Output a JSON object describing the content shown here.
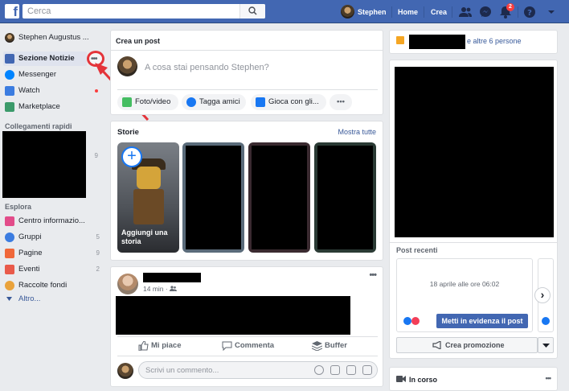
{
  "topbar": {
    "logo": "f",
    "search_placeholder": "Cerca",
    "user_name": "Stephen",
    "home": "Home",
    "create": "Crea",
    "notifications_badge": "2"
  },
  "leftnav": {
    "profile": "Stephen Augustus ...",
    "items": [
      {
        "label": "Sezione Notizie"
      },
      {
        "label": "Messenger"
      },
      {
        "label": "Watch"
      },
      {
        "label": "Marketplace"
      }
    ],
    "shortcuts_title": "Collegamenti rapidi",
    "shortcuts_count": "9",
    "explore_title": "Esplora",
    "explore": [
      {
        "label": "Centro informazio...",
        "count": ""
      },
      {
        "label": "Gruppi",
        "count": "5"
      },
      {
        "label": "Pagine",
        "count": "9"
      },
      {
        "label": "Eventi",
        "count": "2"
      },
      {
        "label": "Raccolte fondi",
        "count": ""
      }
    ],
    "more": "Altro..."
  },
  "composer": {
    "title": "Crea un post",
    "placeholder": "A cosa stai pensando Stephen?",
    "photo": "Foto/video",
    "tag": "Tagga amici",
    "play": "Gioca con gli..."
  },
  "stories": {
    "title": "Storie",
    "show_all": "Mostra tutte",
    "add_story": "Aggiungi una storia"
  },
  "post": {
    "meta": "14 min ·",
    "like": "Mi piace",
    "comment": "Commenta",
    "buffer": "Buffer",
    "comment_placeholder": "Scrivi un commento..."
  },
  "right": {
    "people_text": "e altre 6 persone",
    "recent_title": "Post recenti",
    "recent_date": "18 aprile alle ore 06:02",
    "boost": "Metti in evidenza il post",
    "promotion": "Crea promozione",
    "live_title": "In corso"
  },
  "colors": {
    "brand": "#4267b2",
    "background": "#e9ebee",
    "highlight_ring": "#e4343a"
  }
}
